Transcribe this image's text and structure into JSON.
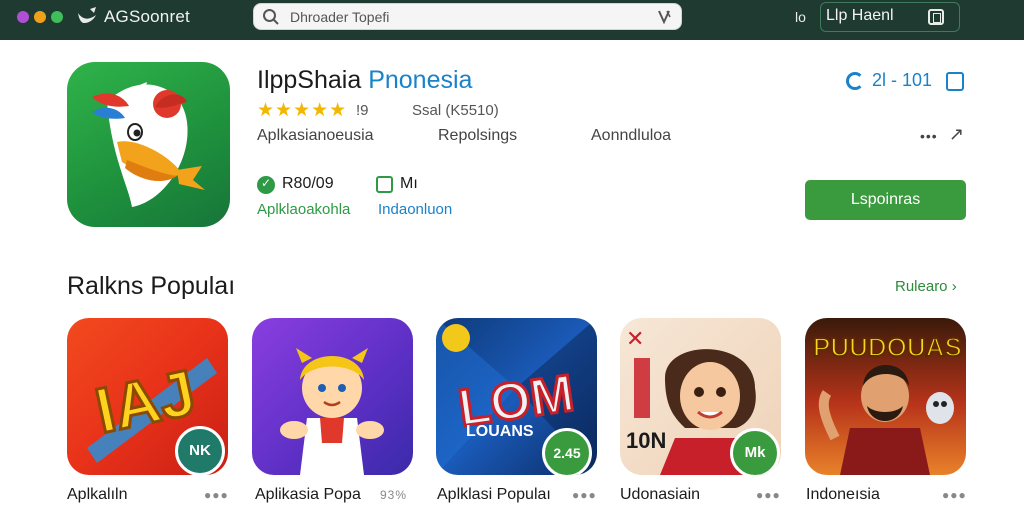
{
  "header": {
    "brand": "AGSoonret",
    "search_value": "Dhroader Topefi",
    "account_label": "Llp Haenl",
    "account_icon_text": "lo"
  },
  "app": {
    "title_main": "IlppShaia",
    "title_dev": "Pnonesia",
    "stars": "★★★★★",
    "rating": "!9",
    "rating_count": "Ssal  (K5510)",
    "category": "Aplkasianoeusia",
    "publisher": "Repolsings",
    "extra": "Aonndluloa",
    "counter": "2l - 101",
    "stat_a_value": "R80/09",
    "stat_a_sub": "Aplklaoakohla",
    "stat_b_value": "Mı",
    "stat_b_sub": "Indaonluon",
    "install_label": "Lspoinras",
    "more_icon": "•••",
    "share_icon": "↗"
  },
  "section": {
    "title": "Ralkns Populaı",
    "see_all": "Rulearo ›"
  },
  "tiles": [
    {
      "label": "Aplkalıln",
      "badge": "NK",
      "dots": "●●●"
    },
    {
      "label": "Aplikasia Popa",
      "badge": "",
      "dots": "93%"
    },
    {
      "label": "Aplklasi Populaı",
      "badge": "2.45",
      "dots": "●●●"
    },
    {
      "label": "Udonasiain",
      "badge": "Mk",
      "dots": "●●●"
    },
    {
      "label": "Indoneısia",
      "badge": "",
      "dots": "●●●"
    }
  ],
  "tile_art": {
    "tile1": "IAJ",
    "tile3_big": "LOM",
    "tile3_small": "LOUANS",
    "tile4_year": "10N",
    "tile5_banner": "PUUDOUAS"
  },
  "colors": {
    "topbar": "#1f3a30",
    "accent_green": "#3a9a3e",
    "accent_blue": "#1a82c9",
    "star": "#f2b705"
  }
}
